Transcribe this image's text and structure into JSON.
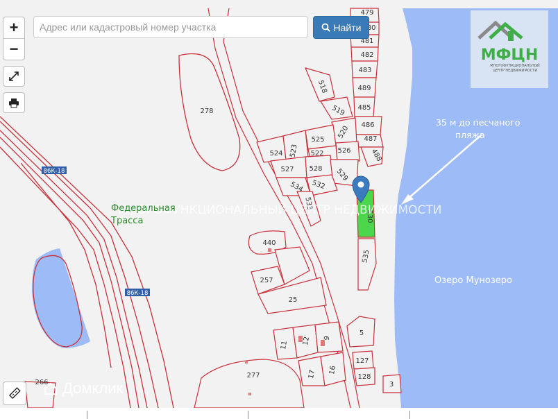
{
  "search": {
    "placeholder": "Адрес или кадастровый номер участка",
    "button_label": "Найти"
  },
  "controls": {
    "zoom_in": "+",
    "zoom_out": "−"
  },
  "logo": {
    "title": "МФЦН",
    "subtitle_line1": "МНОГОФУНКЦИОНАЛЬНЫЙ",
    "subtitle_line2": "ЦЕНТР НЕДВИЖИМОСТИ"
  },
  "overlay_watermark": "МНОГОФУНКЦИОНАЛЬНЫЙ ЦЕНТР НЕДВИЖИМОСТИ",
  "brand_watermark": "Домклик",
  "labels": {
    "lake": "Озеро Мунозеро",
    "beach_line1": "35 м до песчаного",
    "beach_line2": "пляжа",
    "highway_line1": "Федеральная",
    "highway_line2": "Трасса",
    "road_badge_1": "86К-18",
    "road_badge_2": "86К-18"
  },
  "parcels": {
    "p479": "479",
    "p480": "480",
    "p481": "481",
    "p482": "482",
    "p483": "483",
    "p489": "489",
    "p485": "485",
    "p486": "486",
    "p487": "487",
    "p488": "488",
    "p518": "518",
    "p519": "519",
    "p520": "520",
    "p524": "524",
    "p523": "523",
    "p525": "525",
    "p522": "522",
    "p526": "526",
    "p527": "527",
    "p528": "528",
    "p529": "529",
    "p534": "534",
    "p532": "532",
    "p533": "533",
    "p530": "530",
    "p535": "535",
    "p278": "278",
    "p440": "440",
    "p257": "257",
    "p25": "25",
    "p5": "5",
    "p11": "11",
    "p12": "12",
    "p9": "9",
    "p17": "17",
    "p16": "16",
    "p127": "127",
    "p128": "128",
    "p3": "3",
    "p277": "277",
    "p266": "266"
  },
  "colors": {
    "water": "#9dbcf7",
    "parcel_stroke": "#c9303a",
    "selected_parcel": "#4cd64c",
    "marker": "#3b7bbf",
    "highway_label": "#2a8a2a"
  }
}
